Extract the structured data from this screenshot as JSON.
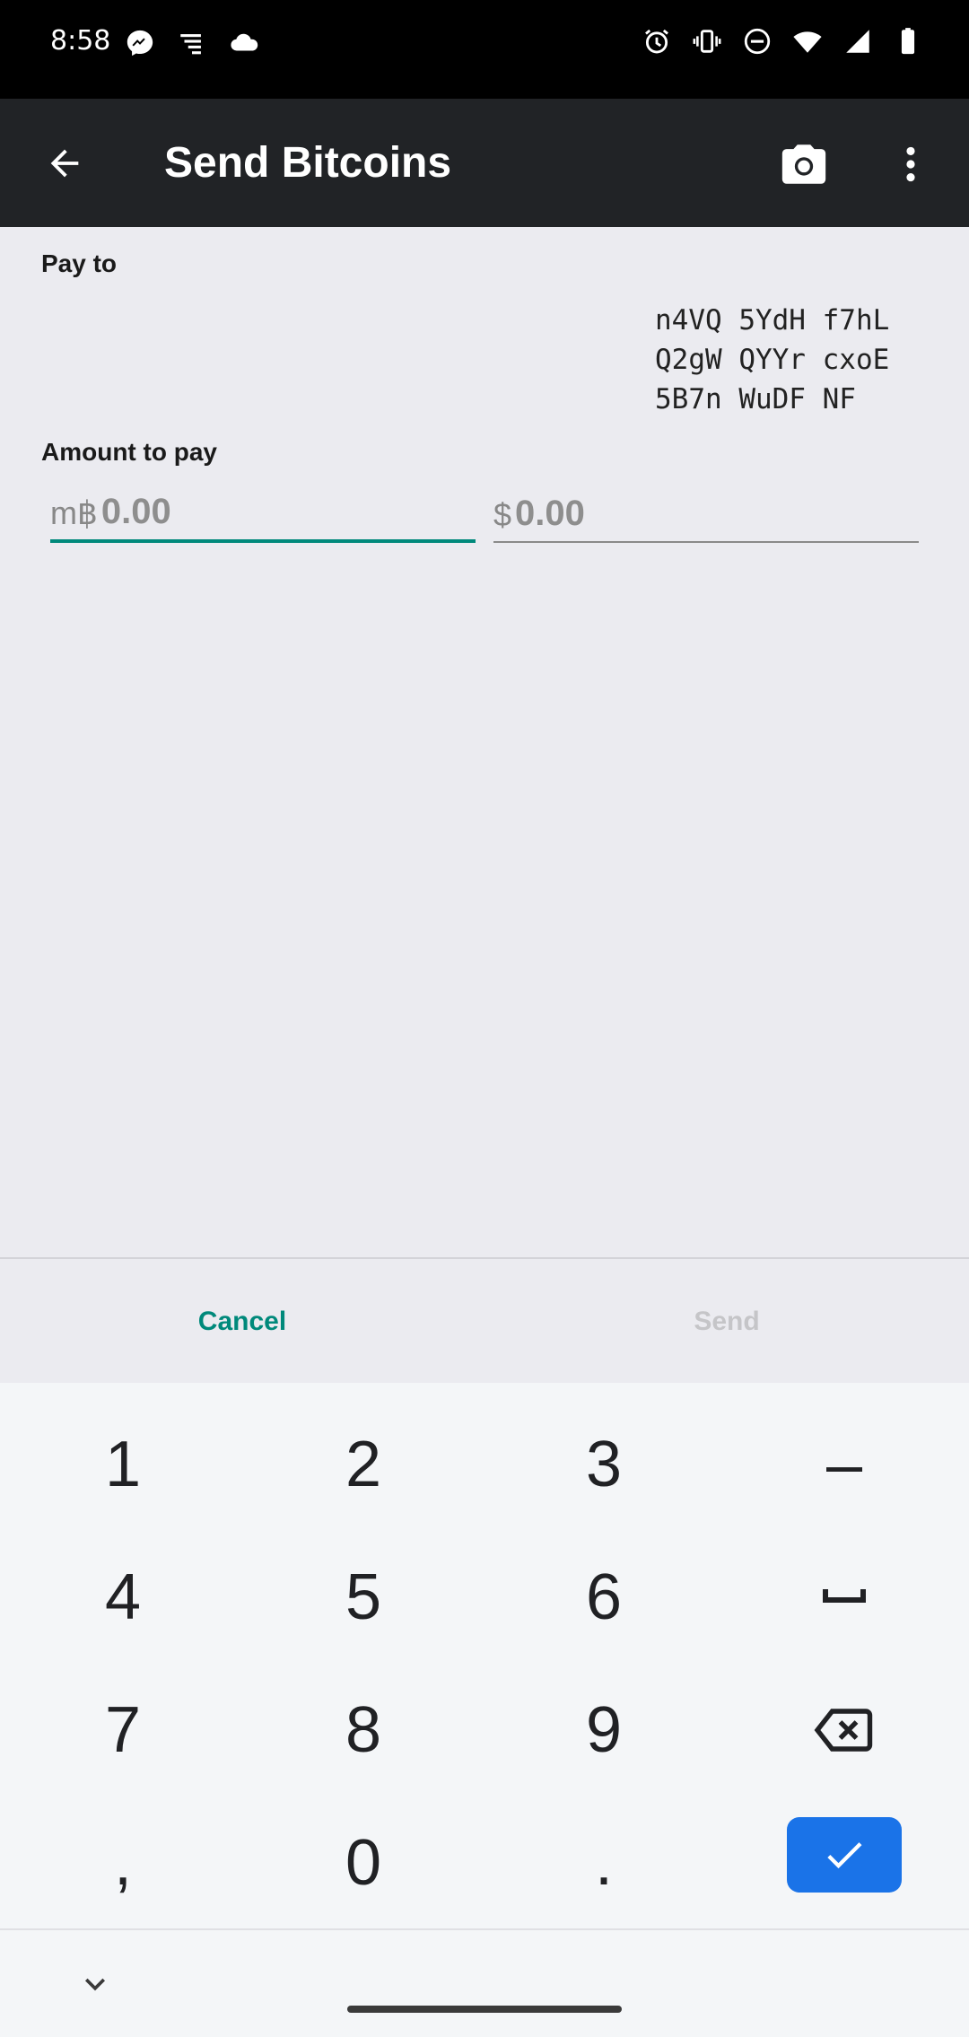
{
  "status_bar": {
    "time": "8:58",
    "left_icons": [
      "messenger-icon",
      "notification-list-icon",
      "cloud-icon"
    ],
    "right_icons": [
      "alarm-icon",
      "vibrate-icon",
      "dnd-icon",
      "wifi-icon",
      "signal-icon",
      "battery-icon"
    ]
  },
  "app_bar": {
    "title": "Send Bitcoins",
    "back_icon": "arrow-back-icon",
    "camera_icon": "camera-icon",
    "menu_icon": "more-vert-icon"
  },
  "form": {
    "pay_to_label": "Pay to",
    "address_lines": [
      "n4VQ 5YdH f7hL",
      "Q2gW QYYr cxoE",
      "5B7n WuDF NF"
    ],
    "amount_label": "Amount to pay",
    "btc_unit": "m฿",
    "btc_value": "0.00",
    "fiat_unit": "$",
    "fiat_value": "0.00"
  },
  "actions": {
    "cancel_label": "Cancel",
    "send_label": "Send"
  },
  "keyboard": {
    "keys": [
      "1",
      "2",
      "3",
      "–",
      "4",
      "5",
      "6",
      "space",
      "7",
      "8",
      "9",
      "backspace",
      ",",
      "0",
      ".",
      "done"
    ],
    "row1": [
      "1",
      "2",
      "3",
      "–"
    ],
    "row2": [
      "4",
      "5",
      "6"
    ],
    "row3": [
      "7",
      "8",
      "9"
    ],
    "row4": [
      ",",
      "0",
      "."
    ]
  },
  "colors": {
    "accent": "#00897b",
    "app_bar": "#212326",
    "done_key": "#1a73e8"
  }
}
